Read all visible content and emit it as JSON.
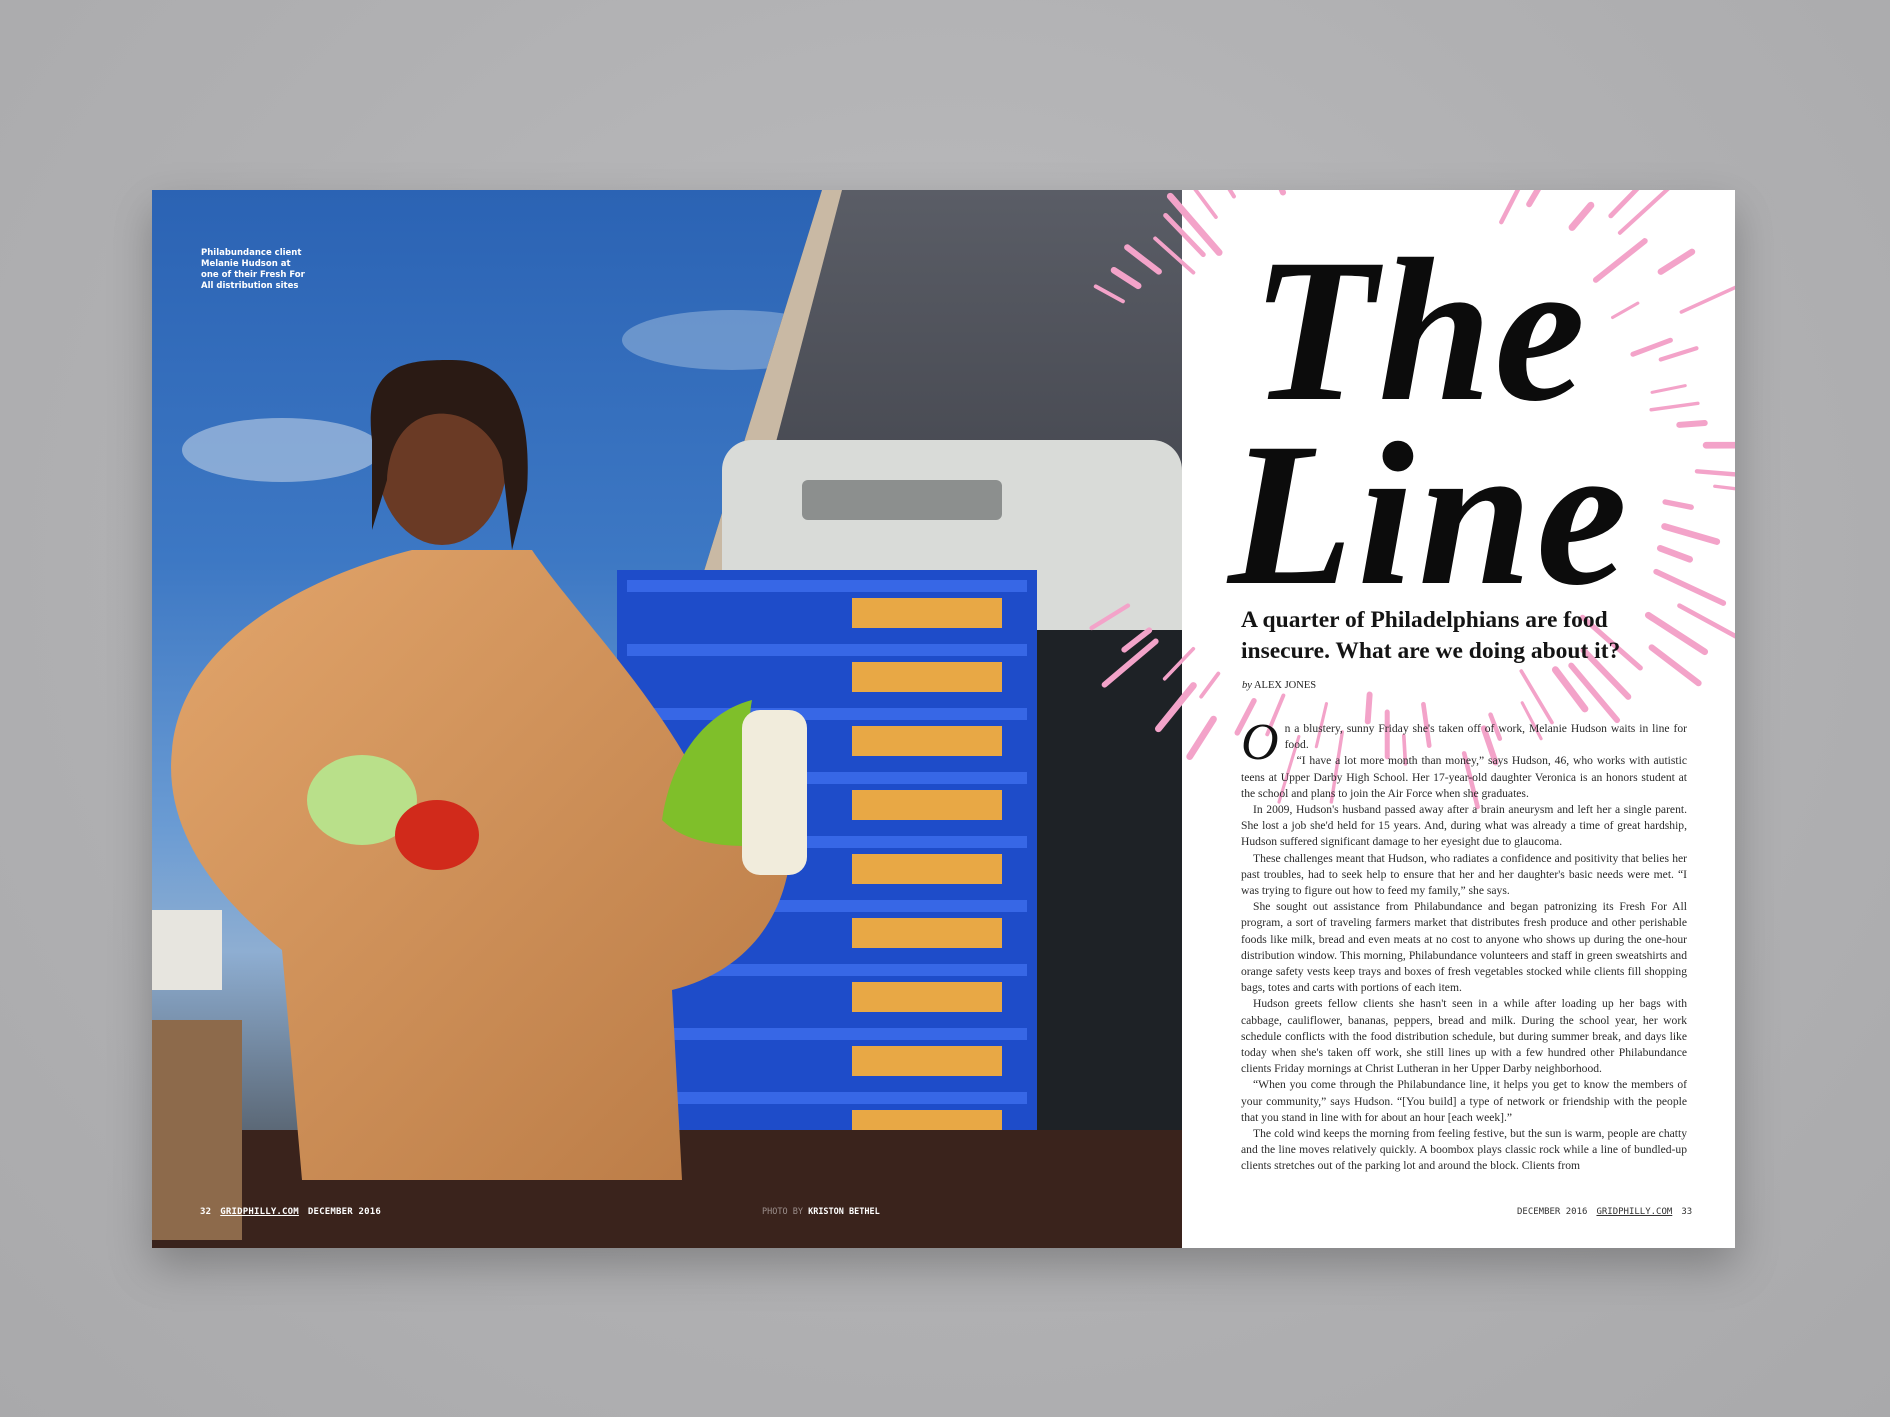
{
  "left_page": {
    "photo_caption": "Philabundance client Melanie Hudson at one of their Fresh For All distribution sites",
    "page_number": "32",
    "site": "GRIDPHILLY.COM",
    "issue": "DECEMBER 2016",
    "photo_credit_prefix": "PHOTO BY",
    "photo_credit_name": "KRISTON BETHEL"
  },
  "right_page": {
    "title_line1": "The",
    "title_line2": "Line",
    "dek": "A quarter of Philadelphians are food insecure. What are we doing about it?",
    "byline_prefix": "by",
    "byline_author": "ALEX JONES",
    "drop_cap": "O",
    "paragraphs": [
      "n a blustery, sunny Friday she's taken off of work, Melanie Hudson waits in line for food.",
      "“I have a lot more month than money,” says Hudson, 46, who works with autistic teens at Upper Darby High School. Her 17-year-old daughter Veronica is an honors student at the school and plans to join the Air Force when she graduates.",
      "In 2009, Hudson's husband passed away after a brain aneurysm and left her a single parent. She lost a job she'd held for 15 years. And, during what was already a time of great hardship, Hudson suffered significant damage to her eyesight due to glaucoma.",
      "These challenges meant that Hudson, who radiates a confidence and positivity that belies her past troubles, had to seek help to ensure that her and her daughter's basic needs were met. “I was trying to figure out how to feed my family,” she says.",
      "She sought out assistance from Philabundance and began patronizing its Fresh For All program, a sort of traveling farmers market that distributes fresh produce and other perishable foods like milk, bread and even meats at no cost to anyone who shows up during the one-hour distribution window. This morning, Philabundance volunteers and staff in green sweatshirts and orange safety vests keep trays and boxes of fresh vegetables stocked while clients fill shopping bags, totes and carts with portions of each item.",
      "Hudson greets fellow clients she hasn't seen in a while after loading up her bags with cabbage, cauliflower, bananas, peppers, bread and milk. During the school year, her work schedule conflicts with the food distribution schedule, but during summer break, and days like today when she's taken off work, she still lines up with a few hundred other Philabundance clients Friday mornings at Christ Lutheran in her Upper Darby neighborhood.",
      "“When you come through the Philabundance line, it helps you get to know the members of your community,” says Hudson. “[You build] a type of network or friendship with the people that you stand in line with for about an hour [each week].”",
      "The cold wind keeps the morning from feeling festive, but the sun is warm, people are chatty and the line moves relatively quickly. A boombox plays classic rock while a line of bundled-up clients stretches out of the parking lot and around the block. Clients from"
    ],
    "issue": "DECEMBER 2016",
    "site": "GRIDPHILLY.COM",
    "page_number": "33"
  },
  "colors": {
    "accent_pink": "#f3a3c9",
    "sky_blue": "#2f69b8",
    "crate_blue": "#1f4fd0",
    "coat_orange": "#d9975e"
  }
}
